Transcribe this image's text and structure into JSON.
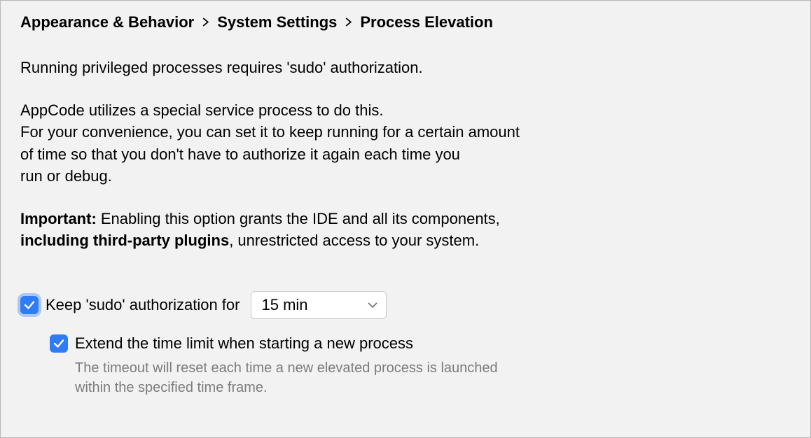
{
  "breadcrumb": {
    "level1": "Appearance & Behavior",
    "level2": "System Settings",
    "level3": "Process Elevation"
  },
  "description": {
    "line1": "Running privileged processes requires 'sudo' authorization.",
    "line2": "AppCode utilizes a special service process to do this.",
    "line3": "For your convenience, you can set it to keep running for a certain amount",
    "line4": "of time so that you don't have to authorize it again each time you",
    "line5": "run or debug.",
    "important_label": "Important:",
    "important_line1_rest": " Enabling this option grants the IDE and all its components,",
    "important_bold2": "including third-party plugins",
    "important_rest2": ", unrestricted access to your system."
  },
  "form": {
    "keep_sudo_label": "Keep 'sudo' authorization for",
    "keep_sudo_checked": true,
    "duration_selected": "15 min",
    "extend_label": "Extend the time limit when starting a new process",
    "extend_checked": true,
    "extend_hint_line1": "The timeout will reset each time a new elevated process is launched",
    "extend_hint_line2": "within the specified time frame."
  }
}
